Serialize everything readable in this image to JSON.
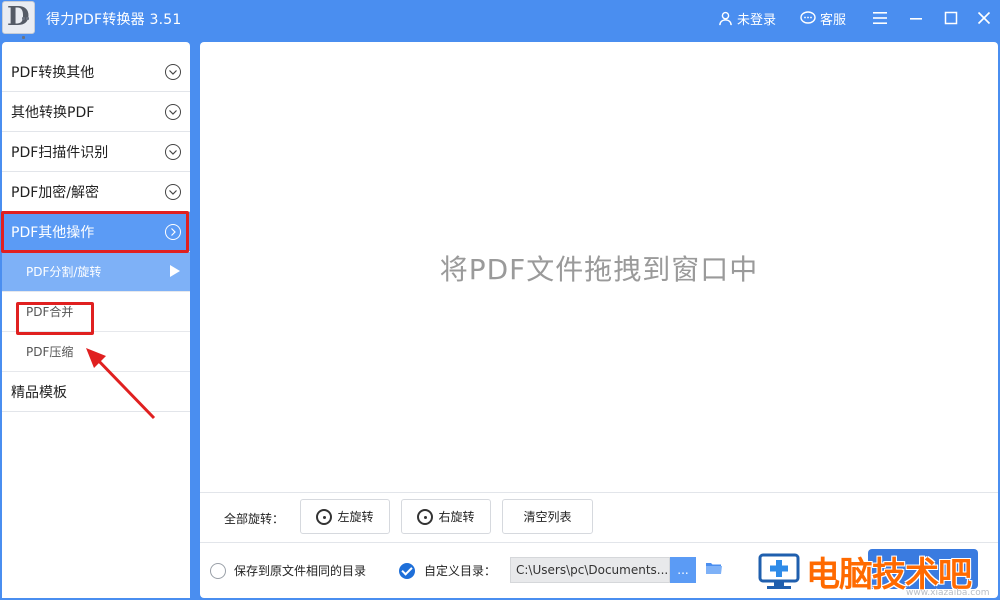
{
  "app": {
    "title": "得力PDF转换器 3.51",
    "logo_letter": "D"
  },
  "titlebar": {
    "login_label": "未登录",
    "service_label": "客服"
  },
  "sidebar": {
    "categories": [
      {
        "label": "PDF转换其他"
      },
      {
        "label": "其他转换PDF"
      },
      {
        "label": "PDF扫描件识别"
      },
      {
        "label": "PDF加密/解密"
      },
      {
        "label": "PDF其他操作"
      }
    ],
    "subitems": [
      {
        "label": "PDF分割/旋转"
      },
      {
        "label": "PDF合并"
      },
      {
        "label": "PDF压缩"
      }
    ],
    "templates_label": "精品模板"
  },
  "main": {
    "drop_hint": "将PDF文件拖拽到窗口中",
    "rotate_all_label": "全部旋转：",
    "rotate_left_label": "左旋转",
    "rotate_right_label": "右旋转",
    "clear_list_label": "清空列表",
    "save_same_dir_label": "保存到原文件相同的目录",
    "custom_dir_label": "自定义目录：",
    "custom_dir_path": "C:\\Users\\pc\\Documents...",
    "browse_label": "..."
  },
  "watermark": {
    "text": "电脑技术吧",
    "url": "www.xiazaiba.com"
  },
  "colors": {
    "accent": "#4a8ef0",
    "active_category": "#5b9bf5",
    "active_subitem": "#7eb1f7",
    "annotation": "#e02020"
  }
}
